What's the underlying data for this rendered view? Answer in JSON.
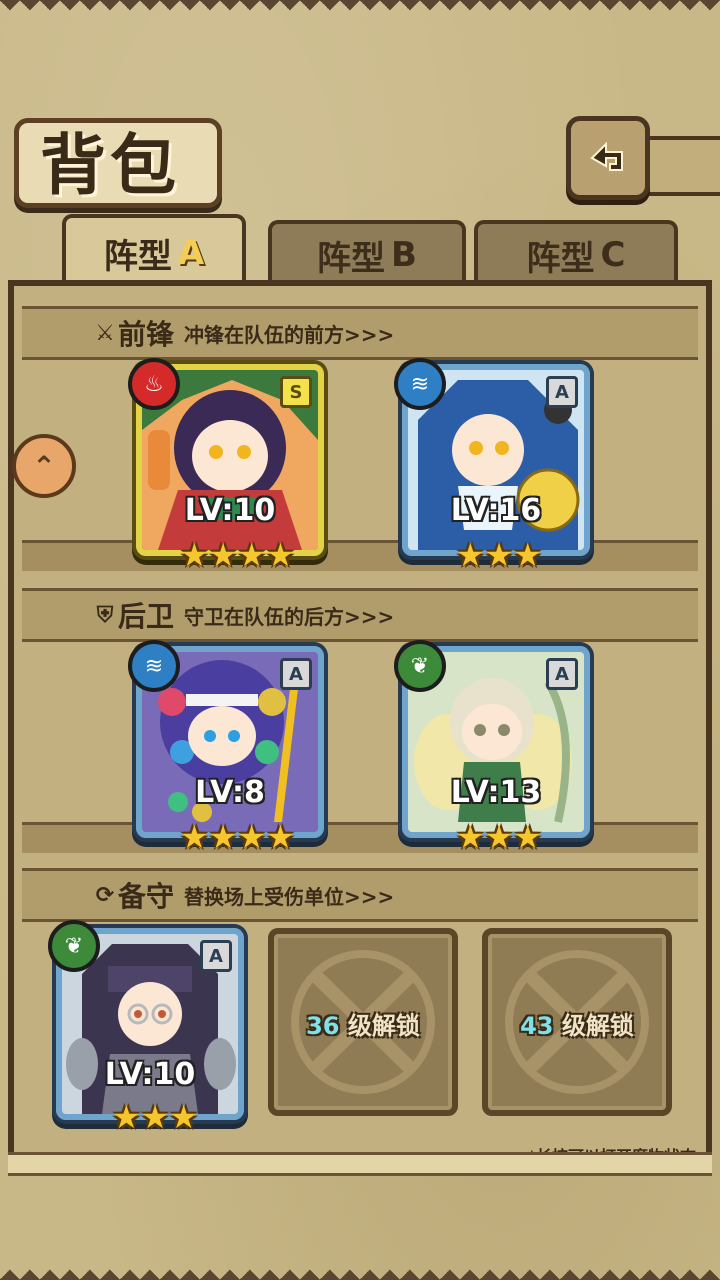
{
  "header": {
    "title": "背包"
  },
  "tabs": [
    {
      "prefix": "阵型",
      "letter": "A",
      "active": true
    },
    {
      "prefix": "阵型",
      "letter": "B",
      "active": false
    },
    {
      "prefix": "阵型",
      "letter": "C",
      "active": false
    }
  ],
  "sections": {
    "front": {
      "name": "前锋",
      "desc": "冲锋在队伍的前方>>>"
    },
    "back": {
      "name": "后卫",
      "desc": "守卫在队伍的后方>>>"
    },
    "reserve": {
      "name": "备守",
      "desc": "替换场上受伤单位>>>"
    }
  },
  "units": [
    {
      "rank": "S",
      "element": "fire",
      "level": "LV:10",
      "stars": 4
    },
    {
      "rank": "A",
      "element": "water",
      "level": "LV:16",
      "stars": 3
    },
    {
      "rank": "A",
      "element": "water",
      "level": "LV:8",
      "stars": 4
    },
    {
      "rank": "A",
      "element": "leaf",
      "level": "LV:13",
      "stars": 3
    },
    {
      "rank": "A",
      "element": "leaf",
      "level": "LV:10",
      "stars": 3
    }
  ],
  "locked_slots": [
    {
      "level": "36",
      "text": "级解锁"
    },
    {
      "level": "43",
      "text": "级解锁"
    }
  ],
  "footer": {
    "hint": "*长按可以打开魔物状态"
  },
  "colors": {
    "fire": "#d42a2a",
    "water": "#2e7fc4",
    "leaf": "#3c8a3a",
    "star": "#f5c62e"
  }
}
